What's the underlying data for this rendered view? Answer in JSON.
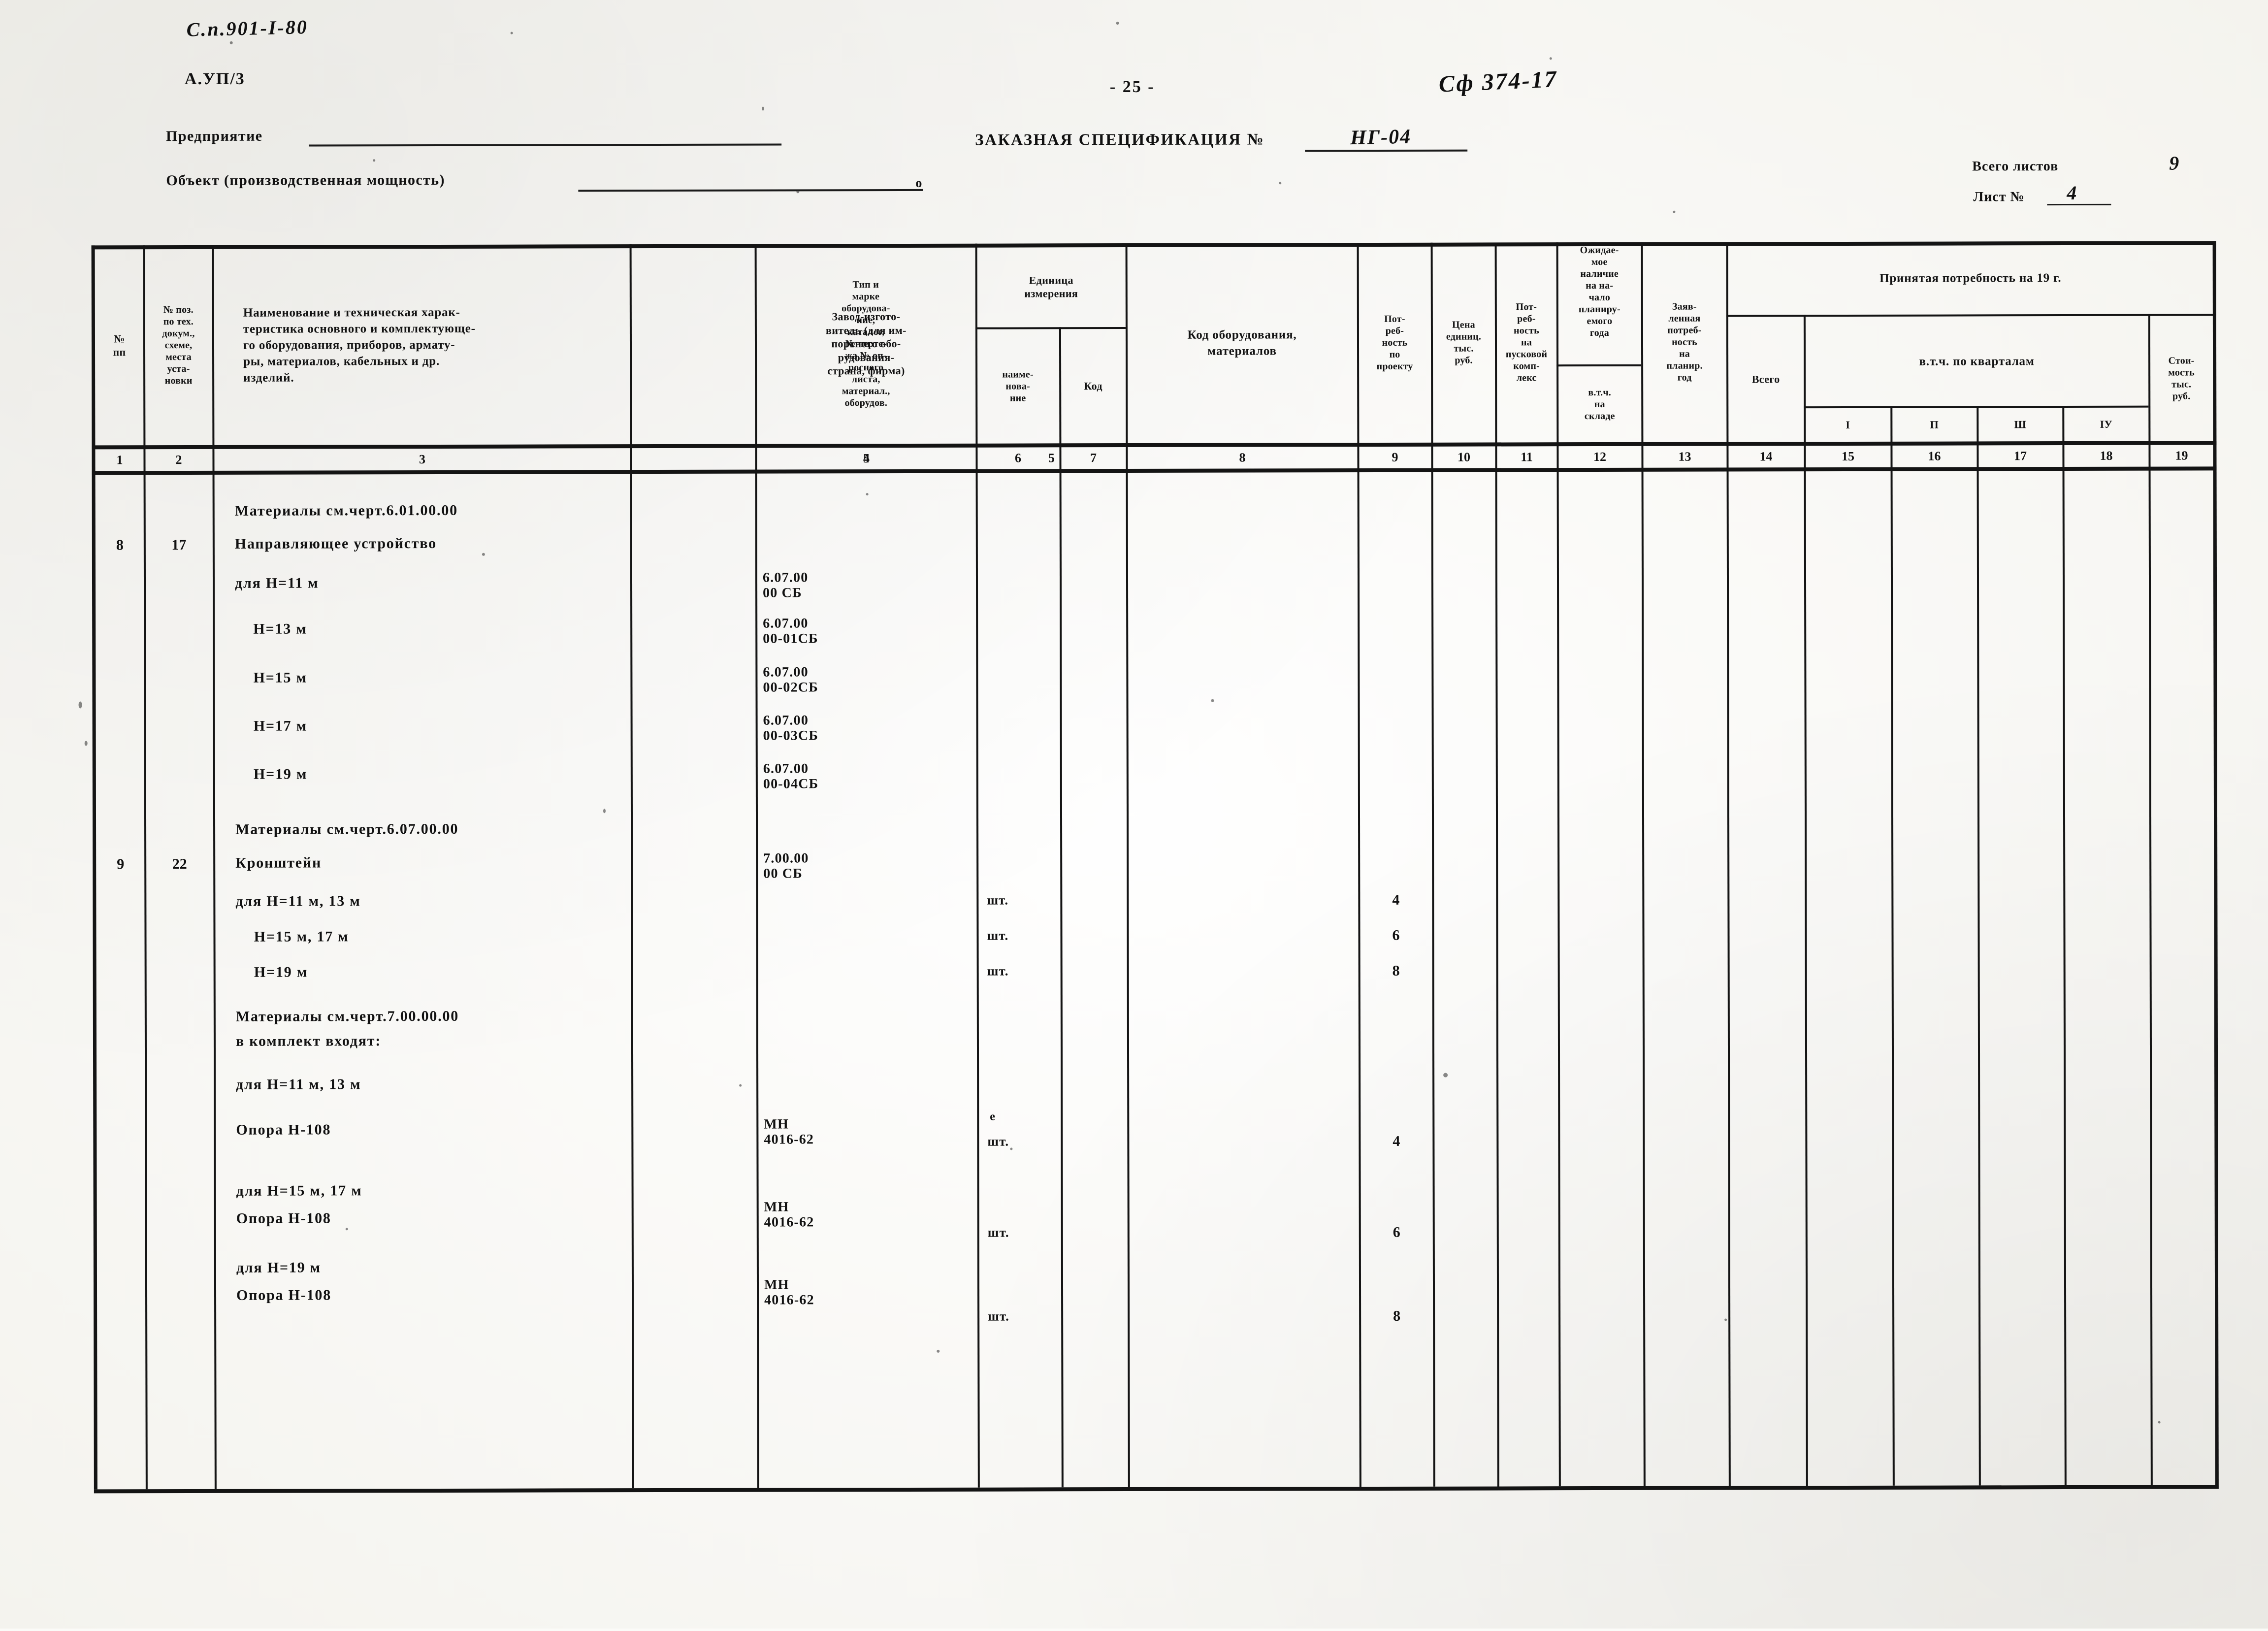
{
  "page": {
    "doc_code": "С.п.901-I-80",
    "sheet_code": "А.УП/3",
    "page_number": "- 25 -",
    "handwritten_ref": "Сф 374-17",
    "field_enterprise_label": "Предприятие",
    "field_object_label": "Объект (производственная мощность)",
    "spec_title": "ЗАКАЗНАЯ СПЕЦИФИКАЦИЯ №",
    "spec_number": "НГ-04",
    "total_sheets_label": "Всего листов",
    "total_sheets_value": "9",
    "sheet_label": "Лист №",
    "sheet_value": "4"
  },
  "table": {
    "headers": {
      "c1": "№\nпп",
      "c2": "№ поз.\nпо тех.\nдокум.,\nсхеме,\nместа\nуста-\nновки",
      "c3": "Наименование и техническая харак-\nтеристика основного и комплектующе-\nго оборудования, приборов, армату-\nры, материалов, кабельных и др.\nизделий.",
      "c4": "Тип и\nмарке\nоборудова-\nние,\nкаталог,\n№ черте-\nжа,№ оп-\nросного\nлиста,\nматериал.,\nоборудов.",
      "c5": "Завод-изгото-\nвитель (для им-\nпортного обо-\nрудования-\nстрана, фирма)",
      "c6_7_group": "Единица\nизмерения",
      "c6": "наиме-\nнова-\nние",
      "c7": "Код",
      "c8": "Код оборудования,\nматериалов",
      "c9": "Пот-\nреб-\nность\nпо\nпроекту",
      "c10": "Цена\nединиц.\nтыс.\nруб.",
      "c11": "Пот-\nреб-\nность\nна\nпусковой\nкомп-\nлекс",
      "c12_group": "Ожидае-\nмое\nналичие\nна на-\nчало\nпланиру-\nемого\nгода",
      "c12": "в.т.ч.\nна\nскладе",
      "c13": "Заяв-\nленная\nпотреб-\nность\nна\nпланир.\nгод",
      "c14_19_group": "Принятая потребность на 19         г.",
      "c14": "Всего",
      "c15_18_group": "в.т.ч. по кварталам",
      "c15": "I",
      "c16": "П",
      "c17": "Ш",
      "c18": "IУ",
      "c19": "Стои-\nмость\nтыс.\nруб."
    },
    "column_numbers": [
      "1",
      "2",
      "3",
      "4",
      "5",
      "6",
      "7",
      "8",
      "9",
      "10",
      "11",
      "12",
      "13",
      "14",
      "15",
      "16",
      "17",
      "18",
      "19"
    ],
    "rows": [
      {
        "num": "",
        "pos": "",
        "name": "Материалы см.черт.6.01.00.00",
        "code": "",
        "unit": "",
        "qty": ""
      },
      {
        "num": "8",
        "pos": "17",
        "name": "Направляющее устройство",
        "code": "",
        "unit": "",
        "qty": ""
      },
      {
        "num": "",
        "pos": "",
        "name": "для Н=11 м",
        "code": "6.07.00\n00 СБ",
        "unit": "",
        "qty": ""
      },
      {
        "num": "",
        "pos": "",
        "name": "    Н=13 м",
        "code": "6.07.00\n00-01СБ",
        "unit": "",
        "qty": ""
      },
      {
        "num": "",
        "pos": "",
        "name": "    Н=15 м",
        "code": "6.07.00\n00-02СБ",
        "unit": "",
        "qty": ""
      },
      {
        "num": "",
        "pos": "",
        "name": "    Н=17 м",
        "code": "6.07.00\n00-03СБ",
        "unit": "",
        "qty": ""
      },
      {
        "num": "",
        "pos": "",
        "name": "    Н=19 м",
        "code": "6.07.00\n00-04СБ",
        "unit": "",
        "qty": ""
      },
      {
        "num": "",
        "pos": "",
        "name": "Материалы см.черт.6.07.00.00",
        "code": "",
        "unit": "",
        "qty": ""
      },
      {
        "num": "9",
        "pos": "22",
        "name": "Кронштейн",
        "code": "7.00.00\n00 СБ",
        "unit": "",
        "qty": ""
      },
      {
        "num": "",
        "pos": "",
        "name": "для Н=11 м, 13 м",
        "code": "",
        "unit": "шт.",
        "qty": "4"
      },
      {
        "num": "",
        "pos": "",
        "name": "    Н=15 м, 17 м",
        "code": "",
        "unit": "шт.",
        "qty": "6"
      },
      {
        "num": "",
        "pos": "",
        "name": "    Н=19 м",
        "code": "",
        "unit": "шт.",
        "qty": "8"
      },
      {
        "num": "",
        "pos": "",
        "name": "Материалы см.черт.7.00.00.00",
        "code": "",
        "unit": "",
        "qty": ""
      },
      {
        "num": "",
        "pos": "",
        "name": "в комплект входят:",
        "code": "",
        "unit": "",
        "qty": ""
      },
      {
        "num": "",
        "pos": "",
        "name": "для Н=11 м, 13 м",
        "code": "",
        "unit": "",
        "qty": ""
      },
      {
        "num": "",
        "pos": "",
        "name": "Опора Н-108",
        "code": "МН\n4016-62",
        "unit": "шт.",
        "qty": "4"
      },
      {
        "num": "",
        "pos": "",
        "name": "для Н=15 м, 17 м",
        "code": "",
        "unit": "",
        "qty": ""
      },
      {
        "num": "",
        "pos": "",
        "name": "Опора Н-108",
        "code": "МН\n4016-62",
        "unit": "шт.",
        "qty": "6"
      },
      {
        "num": "",
        "pos": "",
        "name": "для Н=19 м",
        "code": "",
        "unit": "",
        "qty": ""
      },
      {
        "num": "",
        "pos": "",
        "name": "Опора Н-108",
        "code": "МН\n4016-62",
        "unit": "шт.",
        "qty": "8"
      }
    ]
  }
}
